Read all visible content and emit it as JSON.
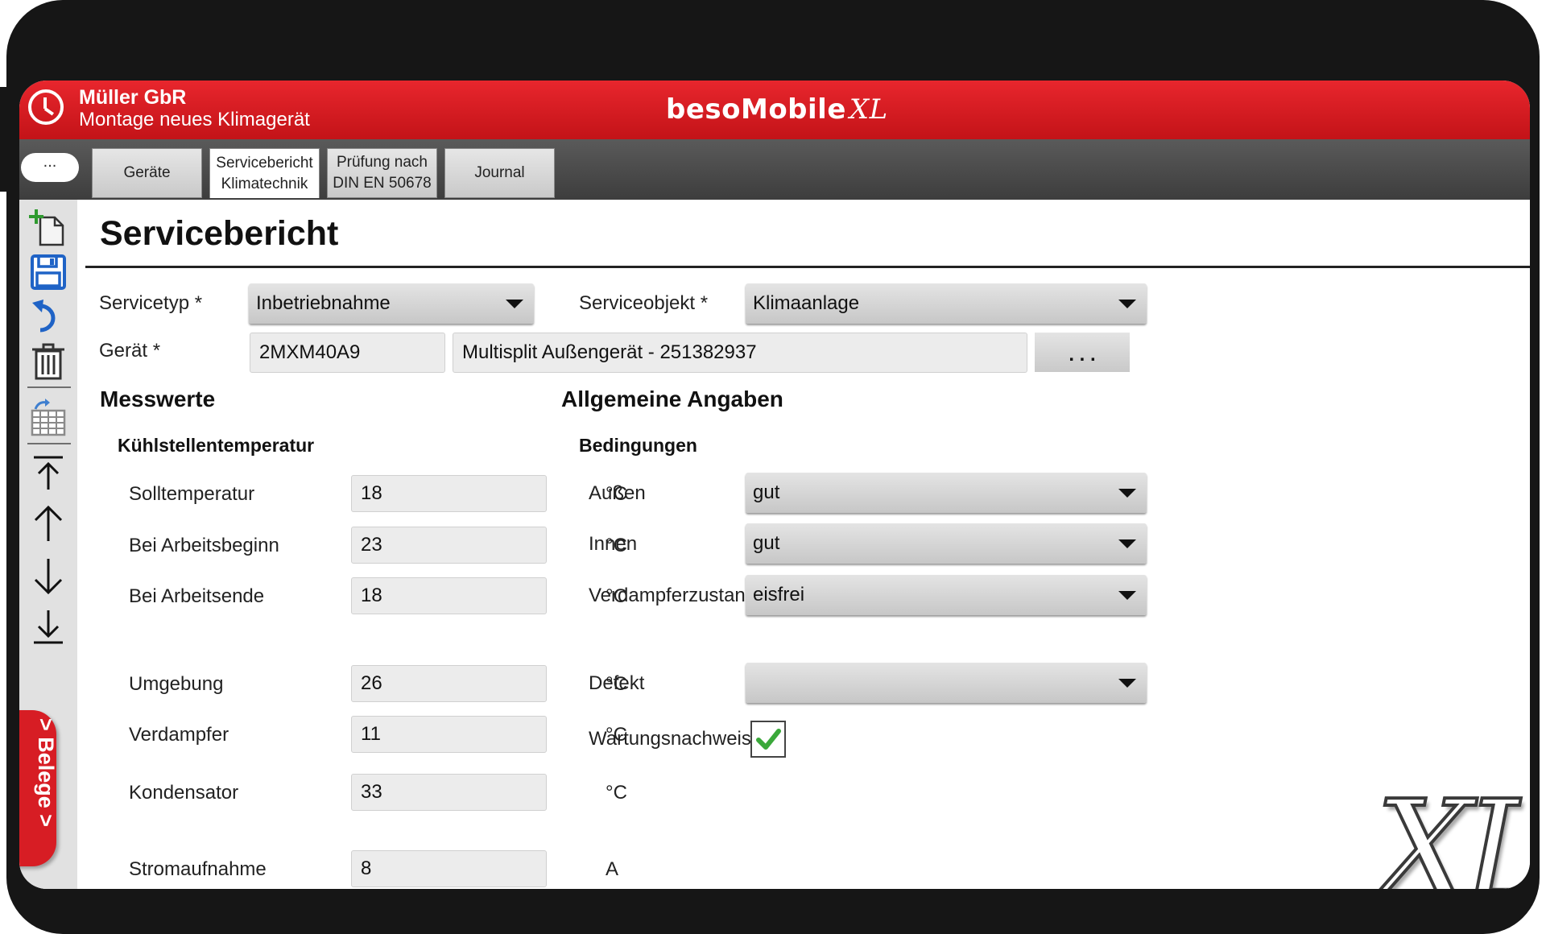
{
  "header": {
    "company": "Müller GbR",
    "subtitle": "Montage neues Klimagerät",
    "brand": "besoMobile",
    "brand_suffix": "XL",
    "accent_color": "#d71d24"
  },
  "tabbar": {
    "menu_label": "...",
    "tabs": [
      {
        "label": "Geräte",
        "active": false
      },
      {
        "label": "Servicebericht\nKlimatechnik",
        "active": true
      },
      {
        "label": "Prüfung nach\nDIN EN 50678",
        "active": false
      },
      {
        "label": "Journal",
        "active": false
      }
    ]
  },
  "sidebar": {
    "icons": [
      "new-document-icon",
      "save-icon",
      "undo-icon",
      "delete-icon",
      "table-import-icon",
      "jump-first-icon",
      "arrow-up-icon",
      "arrow-down-icon",
      "jump-last-icon"
    ],
    "belege_label": "> Belege >"
  },
  "form": {
    "title": "Servicebericht",
    "servicetyp_label": "Servicetyp *",
    "servicetyp_value": "Inbetriebnahme",
    "serviceobjekt_label": "Serviceobjekt *",
    "serviceobjekt_value": "Klimaanlage",
    "geraet_label": "Gerät *",
    "geraet_code": "2MXM40A9",
    "geraet_desc": "Multisplit Außengerät - 251382937",
    "geraet_more": ". . ."
  },
  "messwerte": {
    "title": "Messwerte",
    "subtitle": "Kühlstellentemperatur",
    "rows": [
      {
        "label": "Solltemperatur",
        "value": "18",
        "unit": "°C"
      },
      {
        "label": "Bei Arbeitsbeginn",
        "value": "23",
        "unit": "°C"
      },
      {
        "label": "Bei Arbeitsende",
        "value": "18",
        "unit": "°C"
      },
      {
        "label": "Umgebung",
        "value": "26",
        "unit": "°C"
      },
      {
        "label": "Verdampfer",
        "value": "11",
        "unit": "°C"
      },
      {
        "label": "Kondensator",
        "value": "33",
        "unit": "°C"
      },
      {
        "label": "Stromaufnahme",
        "value": "8",
        "unit": "A"
      }
    ]
  },
  "allgemein": {
    "title": "Allgemeine Angaben",
    "subtitle": "Bedingungen",
    "aussen_label": "Außen",
    "aussen_value": "gut",
    "innen_label": "Innen",
    "innen_value": "gut",
    "verdampfer_label": "Verdampferzustand",
    "verdampfer_value": "eisfrei",
    "defekt_label": "Defekt",
    "defekt_value": "",
    "wartung_label": "Wartungsnachweis",
    "wartung_checked": true
  },
  "watermark": "XL"
}
